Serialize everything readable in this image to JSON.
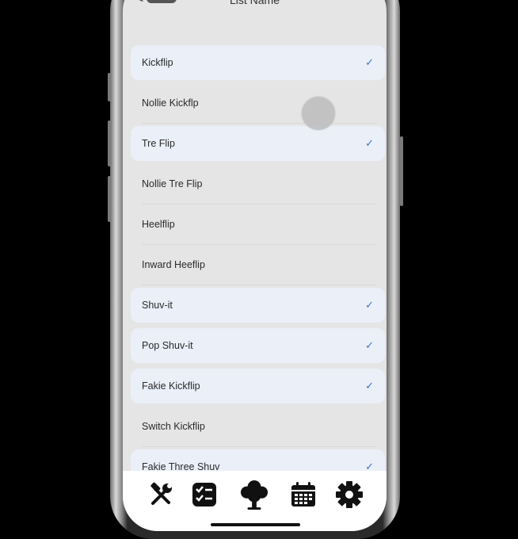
{
  "nav": {
    "back_label": "<",
    "title": "List Name"
  },
  "tricks": [
    {
      "label": "Kickflip",
      "selected": true
    },
    {
      "label": "Nollie Kickflp",
      "selected": false
    },
    {
      "label": "Tre Flip",
      "selected": true
    },
    {
      "label": "Nollie Tre Flip",
      "selected": false
    },
    {
      "label": "Heelflip",
      "selected": false
    },
    {
      "label": "Inward Heeflip",
      "selected": false
    },
    {
      "label": "Shuv-it",
      "selected": true
    },
    {
      "label": "Pop Shuv-it",
      "selected": true
    },
    {
      "label": "Fakie Kickflip",
      "selected": true
    },
    {
      "label": "Switch Kickflip",
      "selected": false
    },
    {
      "label": "Fakie Three Shuv",
      "selected": true
    }
  ],
  "check_glyph": "✓",
  "tabs": [
    {
      "name": "tools-icon"
    },
    {
      "name": "checklist-icon"
    },
    {
      "name": "tree-icon"
    },
    {
      "name": "calendar-icon"
    },
    {
      "name": "gear-icon"
    }
  ],
  "colors": {
    "background": "#e5e5e5",
    "selected_row": "#eaeff8",
    "check": "#3d6fd8",
    "tab_bar": "#ffffff"
  }
}
